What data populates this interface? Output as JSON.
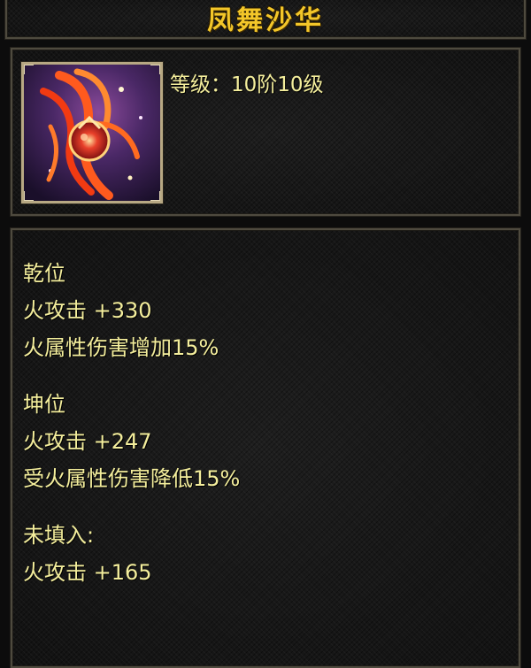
{
  "title": "凤舞沙华",
  "item": {
    "icon": "phoenix-dancer-icon",
    "level_label": "等级：",
    "level_value": "10阶10级"
  },
  "attributes": [
    "乾位",
    "火攻击  +330",
    "火属性伤害增加15%",
    "坤位",
    "火攻击  +247",
    "受火属性伤害降低15%",
    "未填入:",
    "火攻击  +165"
  ],
  "colors": {
    "title": "#f3c629",
    "text": "#f4ee9c",
    "border": "#4e4a3e",
    "frame": "#b7a883"
  }
}
